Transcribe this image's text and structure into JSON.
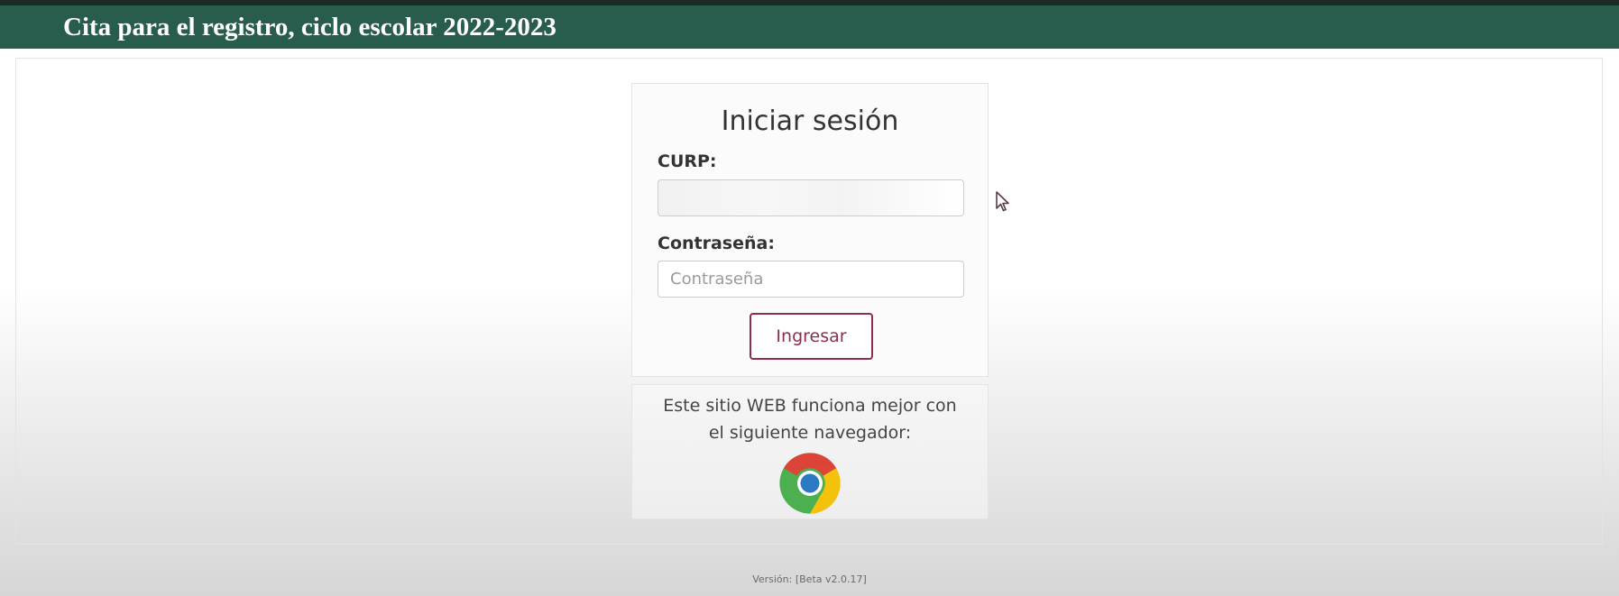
{
  "header": {
    "title": "Cita para el registro, ciclo escolar 2022-2023",
    "color": "#285c4d"
  },
  "login": {
    "title": "Iniciar sesión",
    "curp_label": "CURP:",
    "curp_value": "",
    "password_label": "Contraseña:",
    "password_placeholder": "Contraseña",
    "submit_label": "Ingresar",
    "accent_color": "#8c2d4f"
  },
  "browser_notice": {
    "line1": "Este sitio WEB funciona mejor con",
    "line2": "el siguiente navegador:",
    "icon": "chrome-icon"
  },
  "footer": {
    "version": "Versión: [Beta v2.0.17]"
  }
}
